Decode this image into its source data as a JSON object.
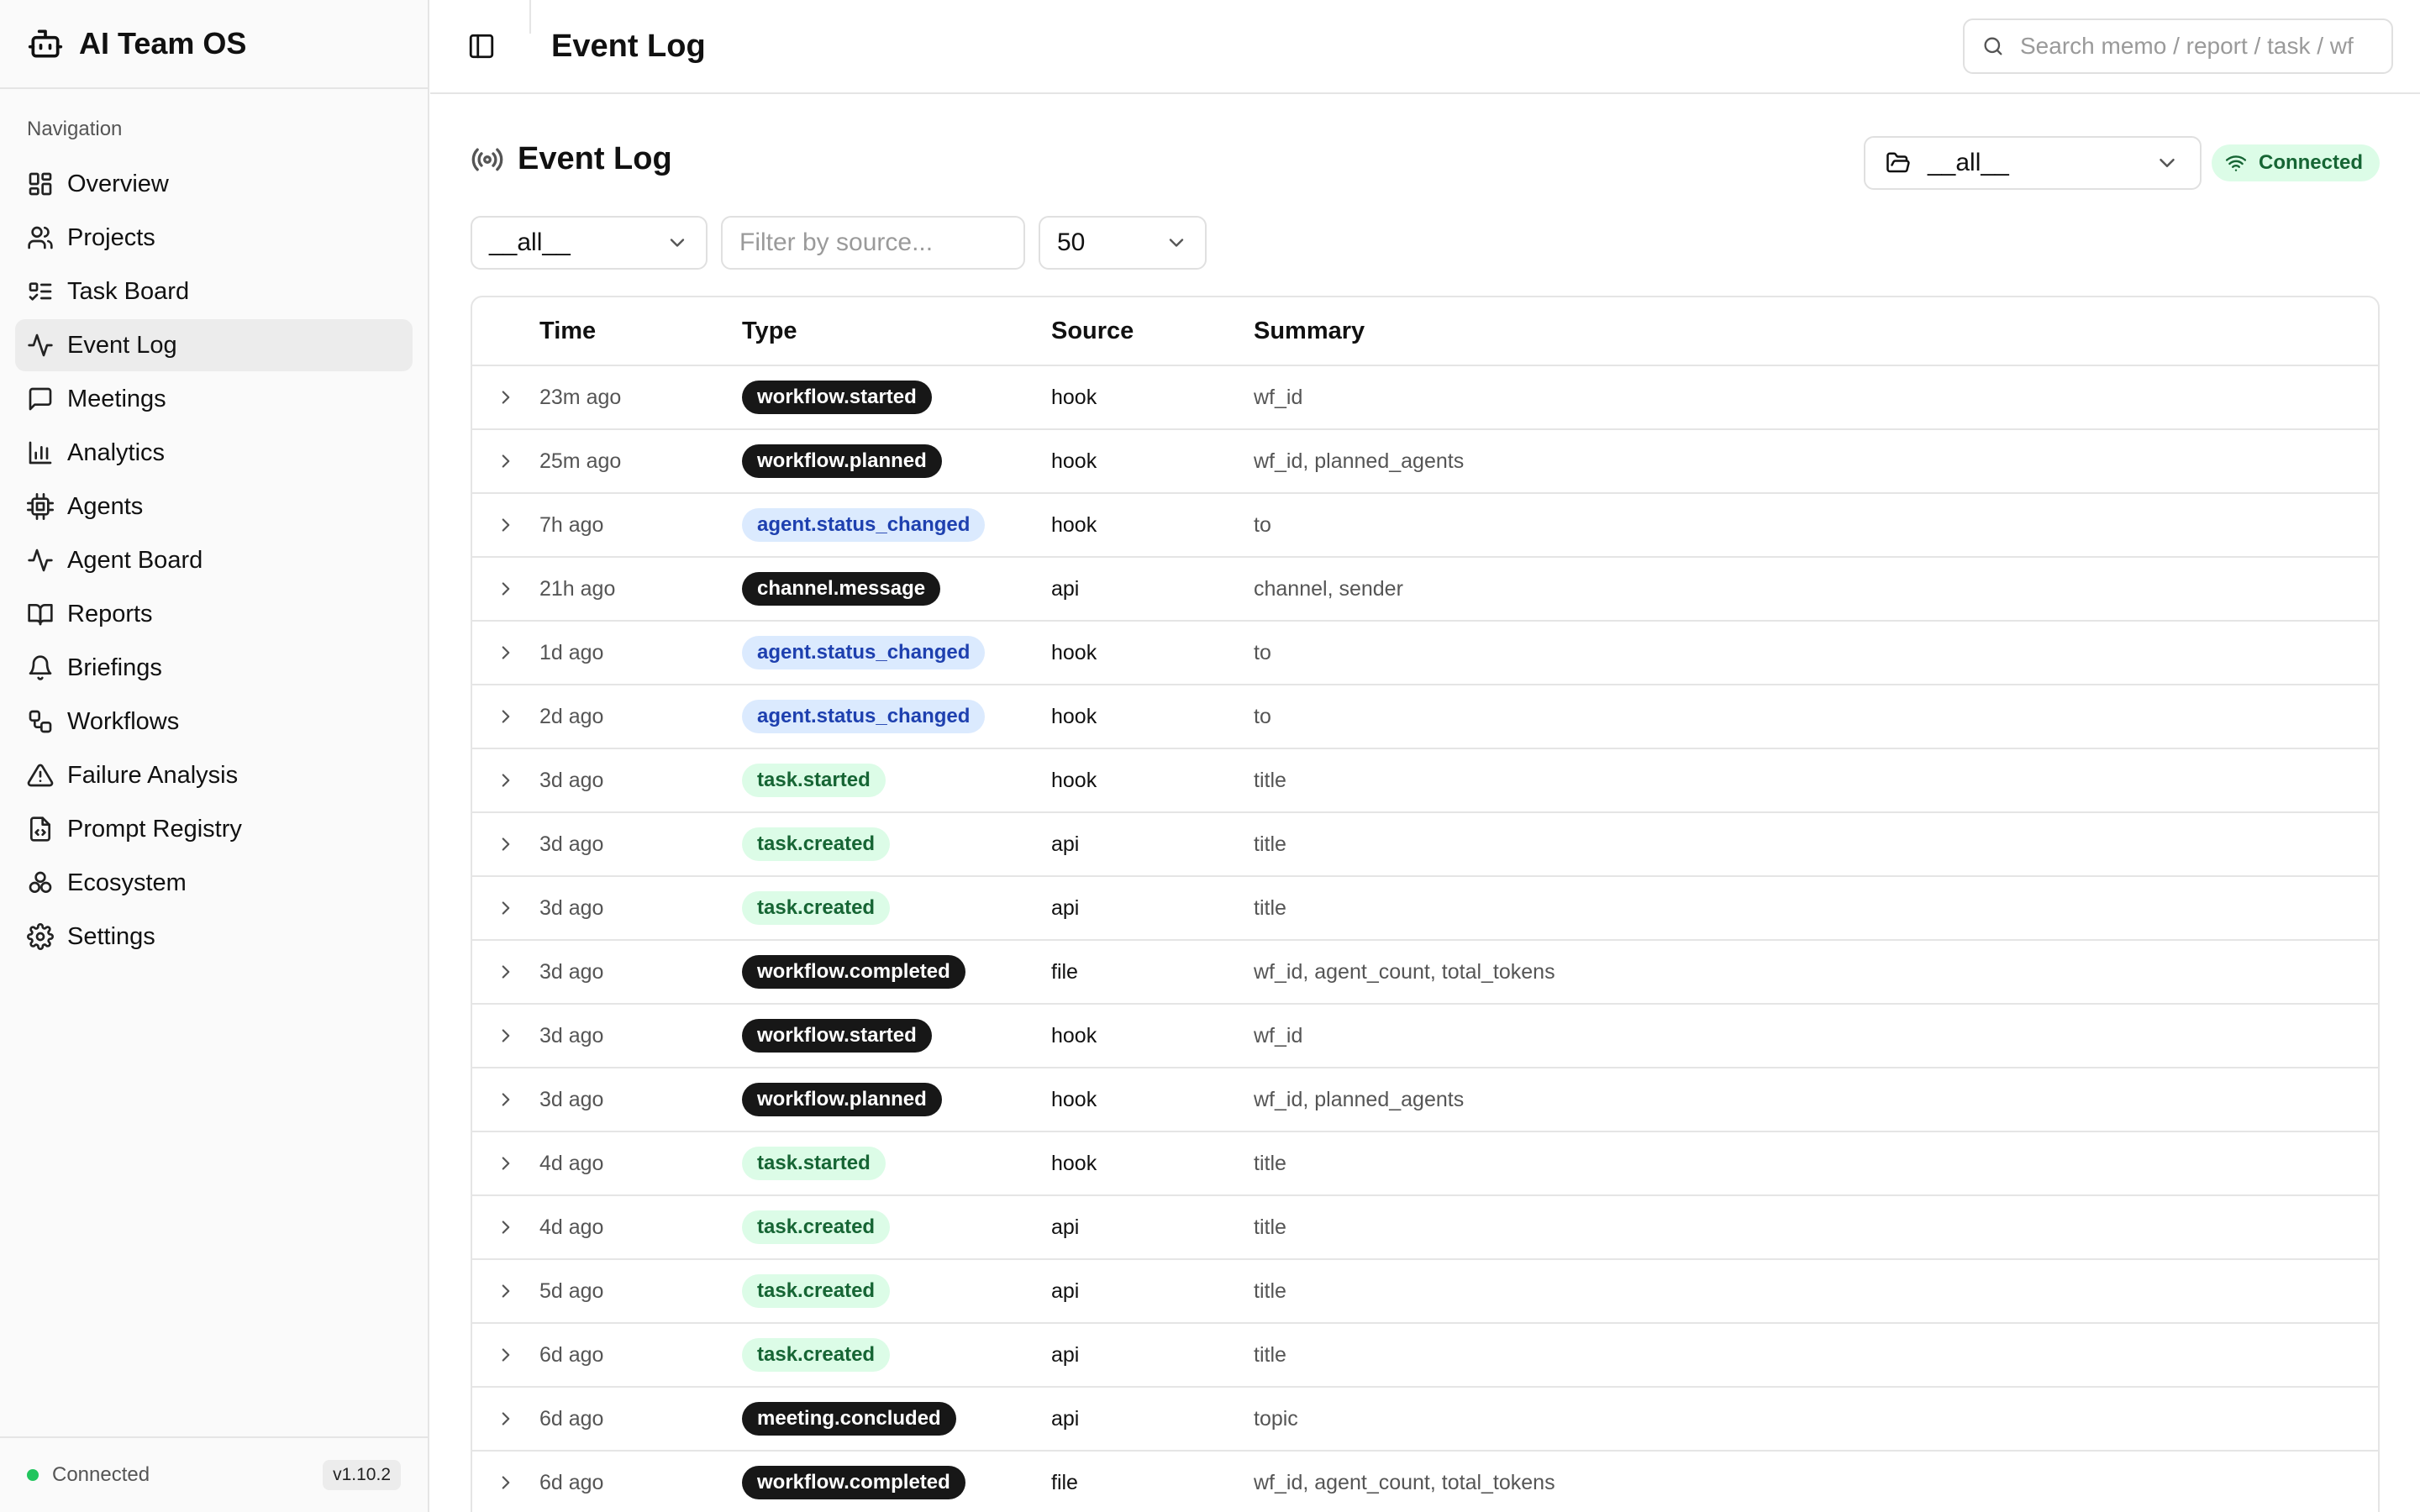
{
  "app": {
    "title": "AI Team OS"
  },
  "nav": {
    "section": "Navigation",
    "items": [
      {
        "label": "Overview",
        "icon": "layout-dashboard-icon"
      },
      {
        "label": "Projects",
        "icon": "users-icon"
      },
      {
        "label": "Task Board",
        "icon": "list-todo-icon"
      },
      {
        "label": "Event Log",
        "icon": "activity-icon",
        "active": true
      },
      {
        "label": "Meetings",
        "icon": "message-square-icon"
      },
      {
        "label": "Analytics",
        "icon": "bar-chart-icon"
      },
      {
        "label": "Agents",
        "icon": "cpu-icon"
      },
      {
        "label": "Agent Board",
        "icon": "activity-icon"
      },
      {
        "label": "Reports",
        "icon": "book-open-icon"
      },
      {
        "label": "Briefings",
        "icon": "bell-icon"
      },
      {
        "label": "Workflows",
        "icon": "workflow-icon"
      },
      {
        "label": "Failure Analysis",
        "icon": "alert-triangle-icon"
      },
      {
        "label": "Prompt Registry",
        "icon": "file-code-icon"
      },
      {
        "label": "Ecosystem",
        "icon": "boxes-icon"
      },
      {
        "label": "Settings",
        "icon": "gear-icon"
      }
    ]
  },
  "footer": {
    "status": "Connected",
    "version": "v1.10.2"
  },
  "header": {
    "title": "Event Log",
    "search_placeholder": "Search memo / report / task / wf"
  },
  "page": {
    "title": "Event Log",
    "project": "__all__",
    "connection": "Connected",
    "filters": {
      "type": "__all__",
      "source_placeholder": "Filter by source...",
      "limit": "50"
    }
  },
  "table": {
    "columns": [
      "Time",
      "Type",
      "Source",
      "Summary"
    ],
    "rows": [
      {
        "time": "23m ago",
        "type": "workflow.started",
        "style": "dark",
        "source": "hook",
        "summary": "wf_id"
      },
      {
        "time": "25m ago",
        "type": "workflow.planned",
        "style": "dark",
        "source": "hook",
        "summary": "wf_id, planned_agents"
      },
      {
        "time": "7h ago",
        "type": "agent.status_changed",
        "style": "blue",
        "source": "hook",
        "summary": "to"
      },
      {
        "time": "21h ago",
        "type": "channel.message",
        "style": "dark",
        "source": "api",
        "summary": "channel, sender"
      },
      {
        "time": "1d ago",
        "type": "agent.status_changed",
        "style": "blue",
        "source": "hook",
        "summary": "to"
      },
      {
        "time": "2d ago",
        "type": "agent.status_changed",
        "style": "blue",
        "source": "hook",
        "summary": "to"
      },
      {
        "time": "3d ago",
        "type": "task.started",
        "style": "green",
        "source": "hook",
        "summary": "title"
      },
      {
        "time": "3d ago",
        "type": "task.created",
        "style": "green",
        "source": "api",
        "summary": "title"
      },
      {
        "time": "3d ago",
        "type": "task.created",
        "style": "green",
        "source": "api",
        "summary": "title"
      },
      {
        "time": "3d ago",
        "type": "workflow.completed",
        "style": "dark",
        "source": "file",
        "summary": "wf_id, agent_count, total_tokens"
      },
      {
        "time": "3d ago",
        "type": "workflow.started",
        "style": "dark",
        "source": "hook",
        "summary": "wf_id"
      },
      {
        "time": "3d ago",
        "type": "workflow.planned",
        "style": "dark",
        "source": "hook",
        "summary": "wf_id, planned_agents"
      },
      {
        "time": "4d ago",
        "type": "task.started",
        "style": "green",
        "source": "hook",
        "summary": "title"
      },
      {
        "time": "4d ago",
        "type": "task.created",
        "style": "green",
        "source": "api",
        "summary": "title"
      },
      {
        "time": "5d ago",
        "type": "task.created",
        "style": "green",
        "source": "api",
        "summary": "title"
      },
      {
        "time": "6d ago",
        "type": "task.created",
        "style": "green",
        "source": "api",
        "summary": "title"
      },
      {
        "time": "6d ago",
        "type": "meeting.concluded",
        "style": "dark",
        "source": "api",
        "summary": "topic"
      },
      {
        "time": "6d ago",
        "type": "workflow.completed",
        "style": "dark",
        "source": "file",
        "summary": "wf_id, agent_count, total_tokens"
      }
    ]
  }
}
